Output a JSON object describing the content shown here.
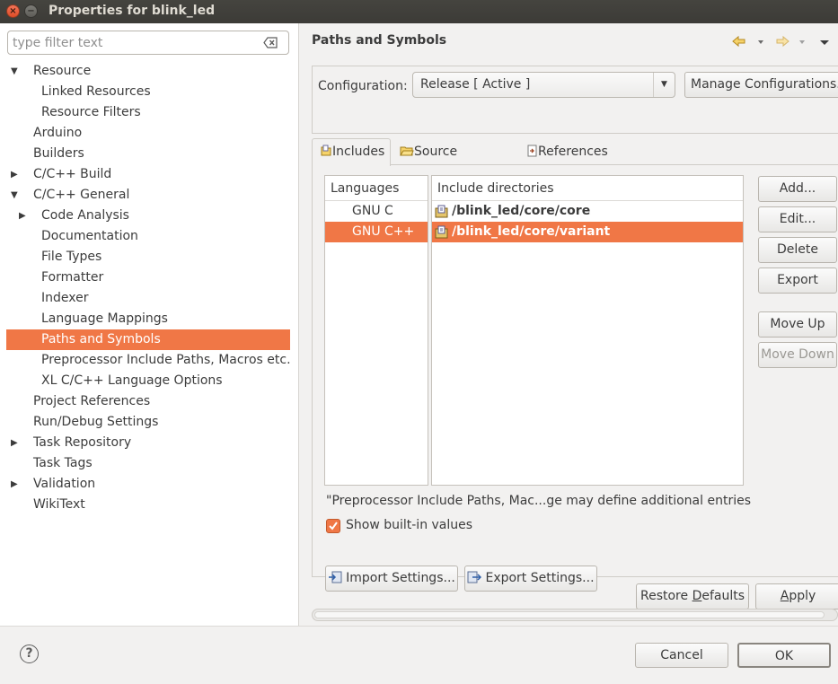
{
  "window": {
    "title": "Properties for blink_led"
  },
  "filter": {
    "placeholder": "type filter text"
  },
  "tree": [
    {
      "label": "Resource",
      "arrow": "▼"
    },
    {
      "label": "Linked Resources",
      "arrow": ""
    },
    {
      "label": "Resource Filters",
      "arrow": ""
    },
    {
      "label": "Arduino",
      "arrow": ""
    },
    {
      "label": "Builders",
      "arrow": ""
    },
    {
      "label": "C/C++ Build",
      "arrow": "▶"
    },
    {
      "label": "C/C++ General",
      "arrow": "▼"
    },
    {
      "label": "Code Analysis",
      "arrow": "▶"
    },
    {
      "label": "Documentation",
      "arrow": ""
    },
    {
      "label": "File Types",
      "arrow": ""
    },
    {
      "label": "Formatter",
      "arrow": ""
    },
    {
      "label": "Indexer",
      "arrow": ""
    },
    {
      "label": "Language Mappings",
      "arrow": ""
    },
    {
      "label": "Paths and Symbols",
      "arrow": "",
      "selected": true
    },
    {
      "label": "Preprocessor Include Paths, Macros etc.",
      "arrow": ""
    },
    {
      "label": "XL C/C++ Language Options",
      "arrow": ""
    },
    {
      "label": "Project References",
      "arrow": ""
    },
    {
      "label": "Run/Debug Settings",
      "arrow": ""
    },
    {
      "label": "Task Repository",
      "arrow": "▶"
    },
    {
      "label": "Task Tags",
      "arrow": ""
    },
    {
      "label": "Validation",
      "arrow": "▶"
    },
    {
      "label": "WikiText",
      "arrow": ""
    }
  ],
  "page": {
    "title": "Paths and Symbols",
    "configuration_label": "Configuration:",
    "configuration_value": "Release  [ Active ]",
    "manage_button": "Manage Configurations...",
    "tabs": [
      {
        "label": "Includes",
        "icon": "includes-icon"
      },
      {
        "label": "Source Location",
        "icon": "folder-icon"
      },
      {
        "label": "References",
        "icon": "references-icon"
      }
    ],
    "languages_header": "Languages",
    "languages": [
      {
        "label": "GNU C",
        "selected": false
      },
      {
        "label": "GNU C++",
        "selected": true
      }
    ],
    "dirs_header": "Include directories",
    "dirs": [
      {
        "label": "/blink_led/core/core",
        "selected": false
      },
      {
        "label": "/blink_led/core/variant",
        "selected": true
      }
    ],
    "buttons": {
      "add": "Add...",
      "edit": "Edit...",
      "delete": "Delete",
      "export": "Export",
      "move_up": "Move Up",
      "move_down": "Move Down"
    },
    "note": "\"Preprocessor Include Paths, Mac...ge may define additional entries",
    "show_builtin": "Show built-in values",
    "import_settings": "Import Settings...",
    "export_settings": "Export Settings...",
    "restore_defaults_pre": "Restore ",
    "restore_defaults_u": "D",
    "restore_defaults_post": "efaults",
    "apply_u": "A",
    "apply_post": "pply"
  },
  "footer": {
    "cancel": "Cancel",
    "ok": "OK"
  },
  "colors": {
    "selection": "#f07746",
    "titlebar": "#3c3b37"
  }
}
